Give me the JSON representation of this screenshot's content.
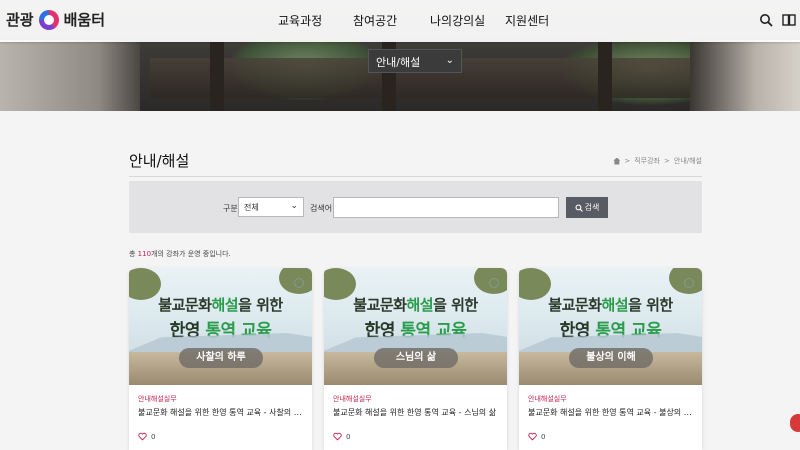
{
  "header": {
    "logo_left": "관광",
    "logo_right": "배움터",
    "nav": [
      "교육과정",
      "참여공간",
      "나의강의실",
      "지원센터"
    ],
    "icons": [
      "search-icon",
      "book-icon"
    ]
  },
  "hero": {
    "category_selected": "안내/해설"
  },
  "page": {
    "title": "안내/해설",
    "breadcrumb": [
      "직무강좌",
      "안내/해설"
    ]
  },
  "search": {
    "type_label": "구분",
    "type_value": "전체",
    "keyword_label": "검색어",
    "keyword_value": "",
    "button_label": "검색"
  },
  "result": {
    "prefix": "총 ",
    "count": "110",
    "suffix": "개의 강좌가 운영 중입니다."
  },
  "cards": [
    {
      "headline_a": "불교문화",
      "headline_b": "해설",
      "headline_c": "을 위한",
      "headline2_a": "한영 ",
      "headline2_b": "통역",
      "headline2_c": " 교육",
      "badge": "사찰의 하루",
      "category": "안내해설실무",
      "title": "불교문화 해설을 위한 한영 통역 교육 - 사찰의 하루",
      "likes": "0"
    },
    {
      "headline_a": "불교문화",
      "headline_b": "해설",
      "headline_c": "을 위한",
      "headline2_a": "한영 ",
      "headline2_b": "통역",
      "headline2_c": " 교육",
      "badge": "스님의 삶",
      "category": "안내해설실무",
      "title": "불교문화 해설을 위한 한영 통역 교육 - 스님의 삶",
      "likes": "0"
    },
    {
      "headline_a": "불교문화",
      "headline_b": "해설",
      "headline_c": "을 위한",
      "headline2_a": "한영 ",
      "headline2_b": "통역",
      "headline2_c": " 교육",
      "badge": "불상의 이해",
      "category": "안내해설실무",
      "title": "불교문화 해설을 위한 한영 통역 교육 - 불상의 이해",
      "likes": "0"
    }
  ],
  "colors": {
    "accent": "#c7234e",
    "search_button": "#585a64",
    "headline_green": "#2a9c4c"
  }
}
